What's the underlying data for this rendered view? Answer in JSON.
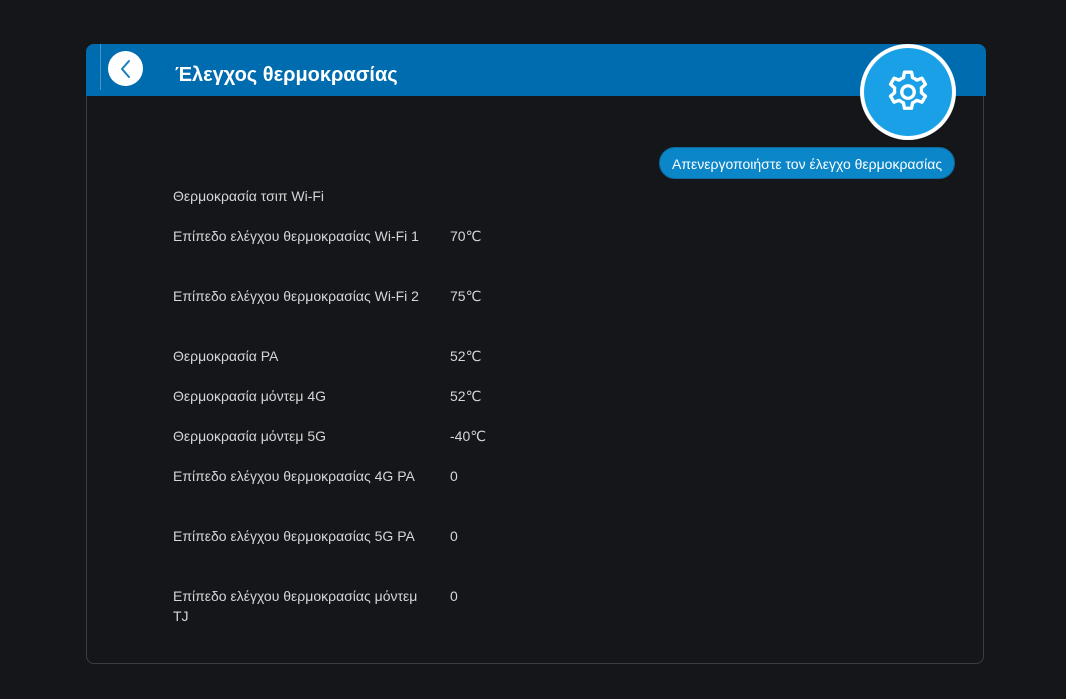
{
  "header": {
    "title": "Έλεγχος θερμοκρασίας",
    "back_icon": "chevron-left-icon",
    "settings_icon": "gear-icon",
    "accent_color": "#006cb0",
    "badge_color": "#1aa0e6"
  },
  "actions": {
    "disable_label": "Απενεργοποιήστε τον έλεγχο θερμοκρασίας"
  },
  "section": {
    "label": "Θερμοκρασία τσιπ Wi-Fi"
  },
  "rows": [
    {
      "label": "Επίπεδο ελέγχου θερμοκρασίας Wi-Fi 1",
      "value": "70℃"
    },
    {
      "label": "Επίπεδο ελέγχου θερμοκρασίας Wi-Fi 2",
      "value": "75℃"
    },
    {
      "label": "Θερμοκρασία PA",
      "value": "52℃"
    },
    {
      "label": "Θερμοκρασία μόντεμ 4G",
      "value": "52℃"
    },
    {
      "label": "Θερμοκρασία μόντεμ 5G",
      "value": "-40℃"
    },
    {
      "label": "Επίπεδο ελέγχου θερμοκρασίας 4G PA",
      "value": "0"
    },
    {
      "label": "Επίπεδο ελέγχου θερμοκρασίας 5G PA",
      "value": "0"
    },
    {
      "label": "Επίπεδο ελέγχου θερμοκρασίας μόντεμ TJ",
      "value": "0"
    }
  ]
}
